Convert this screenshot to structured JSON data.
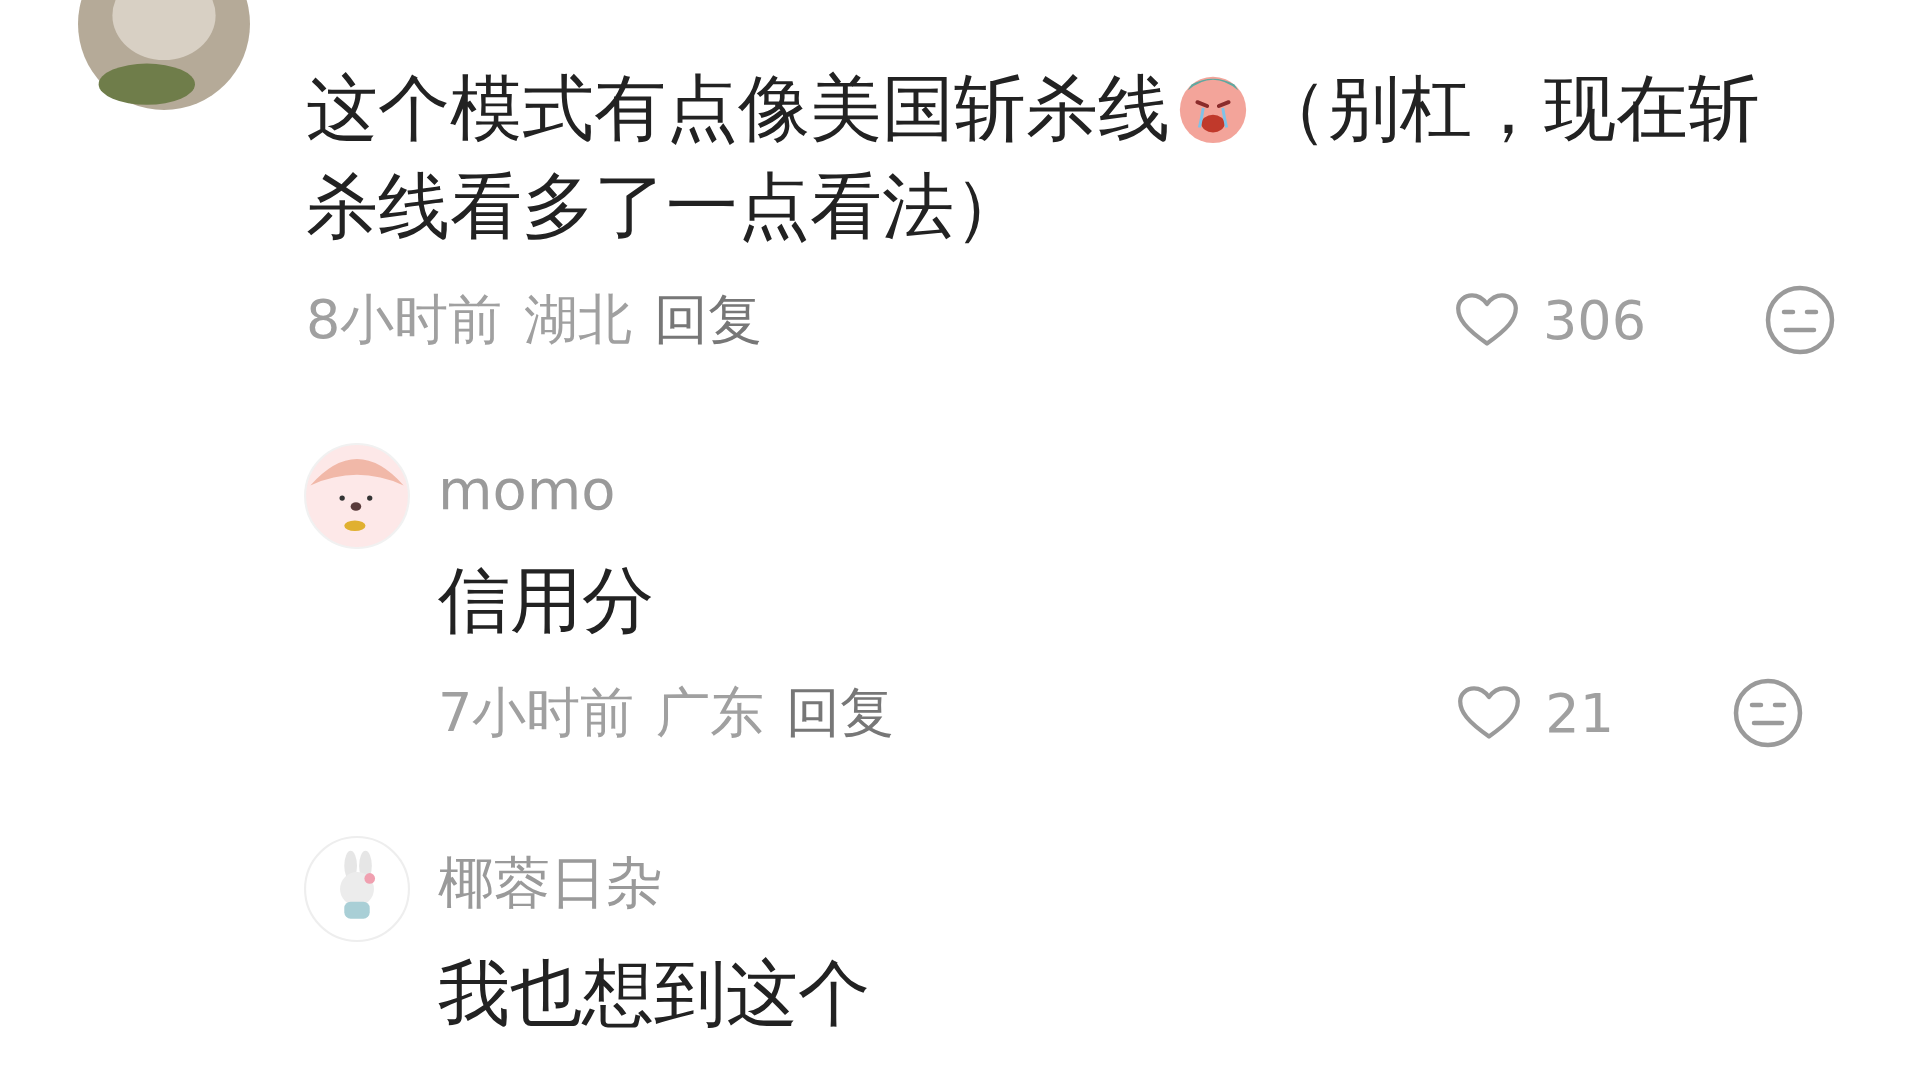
{
  "comment": {
    "avatar": {
      "kind": "photo"
    },
    "lines": [
      [
        {
          "kind": "text",
          "text": "这个模式有点像美国斩杀线"
        },
        {
          "kind": "emoji"
        },
        {
          "kind": "text",
          "text": "（别杠，现在斩"
        }
      ],
      [
        {
          "kind": "text",
          "text": "杀线看多了一点看法）"
        }
      ]
    ],
    "time": "8小时前",
    "location": "湖北",
    "reply": "回复",
    "likes": "306"
  },
  "replies": [
    {
      "avatar": {
        "kind": "pink"
      },
      "name": "momo",
      "text": "信用分",
      "time": "7小时前",
      "location": "广东",
      "reply": "回复",
      "likes": "21"
    },
    {
      "avatar": {
        "kind": "white"
      },
      "name": "椰蓉日杂",
      "text": "我也想到这个"
    }
  ]
}
